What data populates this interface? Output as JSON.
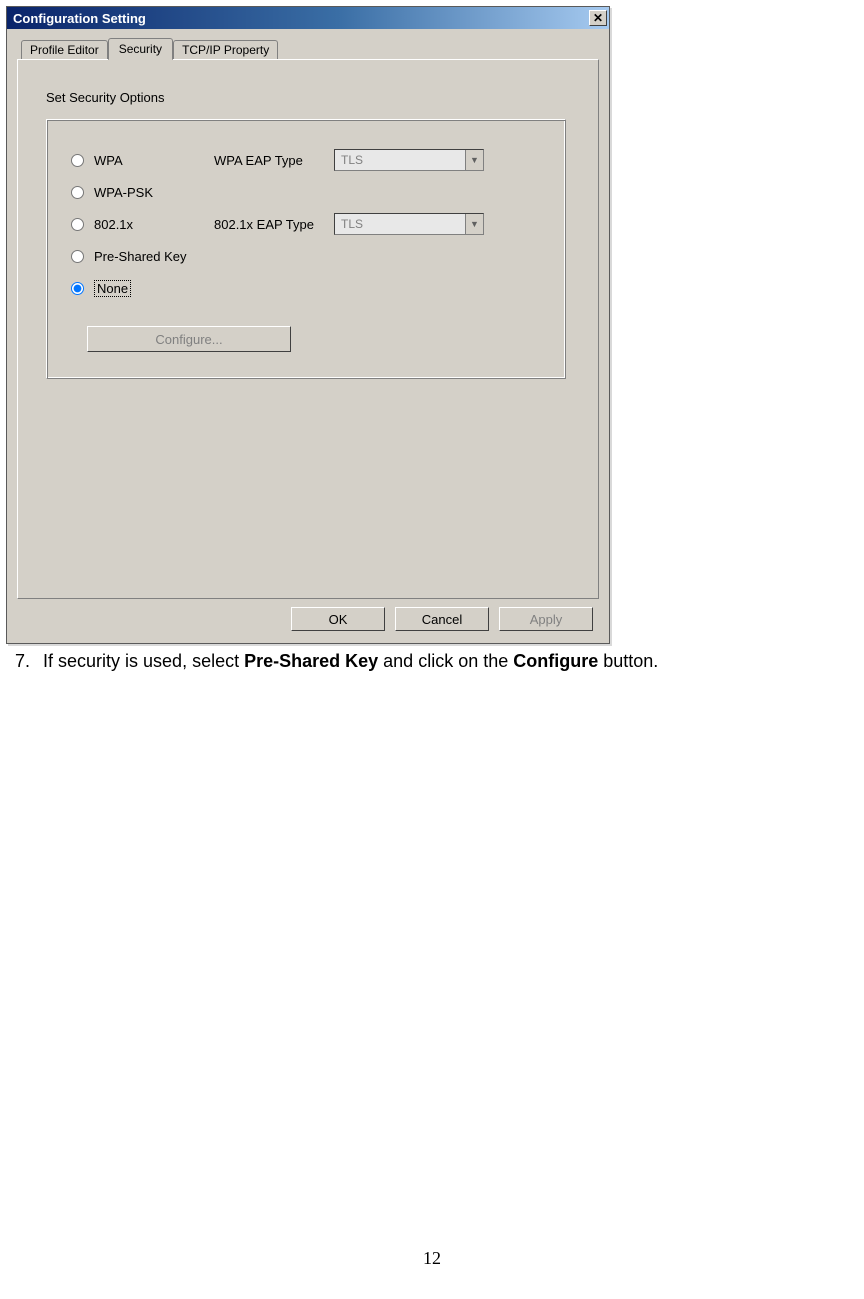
{
  "dialog": {
    "title": "Configuration Setting",
    "tabs": [
      {
        "label": "Profile Editor",
        "active": false
      },
      {
        "label": "Security",
        "active": true
      },
      {
        "label": "TCP/IP Property",
        "active": false
      }
    ],
    "group_title": "Set Security Options",
    "options": [
      {
        "label": "WPA",
        "type_label": "WPA EAP Type",
        "type_value": "TLS",
        "has_combo": true
      },
      {
        "label": "WPA-PSK",
        "has_combo": false
      },
      {
        "label": "802.1x",
        "type_label": "802.1x EAP Type",
        "type_value": "TLS",
        "has_combo": true
      },
      {
        "label": "Pre-Shared Key",
        "has_combo": false
      },
      {
        "label": "None",
        "has_combo": false,
        "selected": true
      }
    ],
    "configure_label": "Configure...",
    "buttons": {
      "ok": "OK",
      "cancel": "Cancel",
      "apply": "Apply"
    }
  },
  "step": {
    "number": "7.",
    "text_prefix": "If security is used, select ",
    "bold1": "Pre-Shared Key",
    "text_mid": " and click on the ",
    "bold2": "Configure",
    "text_suffix": " button."
  },
  "page_number": "12"
}
